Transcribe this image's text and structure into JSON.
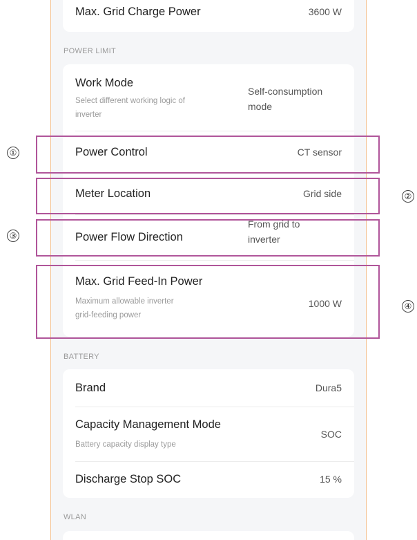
{
  "colors": {
    "highlight": "#b0559a",
    "frame": "#f3c08e",
    "background": "#f5f6f8"
  },
  "grid_charge": {
    "label": "Max. Grid Charge Power",
    "value": "3600 W"
  },
  "power_limit": {
    "section": "POWER LIMIT",
    "work_mode": {
      "label": "Work Mode",
      "sub": "Select different working logic of inverter",
      "value_line1": "Self-consumption",
      "value_line2": "mode"
    },
    "power_control": {
      "label": "Power Control",
      "value": "CT sensor"
    },
    "meter_location": {
      "label": "Meter Location",
      "value": "Grid side"
    },
    "power_flow": {
      "label": "Power Flow Direction",
      "value_line1": "From grid to",
      "value_line2": "inverter"
    },
    "feed_in": {
      "label": "Max. Grid Feed-In Power",
      "sub_line1": "Maximum allowable inverter",
      "sub_line2": "grid-feeding power",
      "value": "1000 W"
    }
  },
  "battery": {
    "section": "BATTERY",
    "brand": {
      "label": "Brand",
      "value": "Dura5"
    },
    "capacity": {
      "label": "Capacity Management Mode",
      "sub": "Battery capacity display type",
      "value": "SOC"
    },
    "stop_soc": {
      "label": "Discharge Stop SOC",
      "value": "15 %"
    }
  },
  "wlan": {
    "section": "WLAN"
  },
  "markers": [
    "①",
    "②",
    "③",
    "④"
  ]
}
